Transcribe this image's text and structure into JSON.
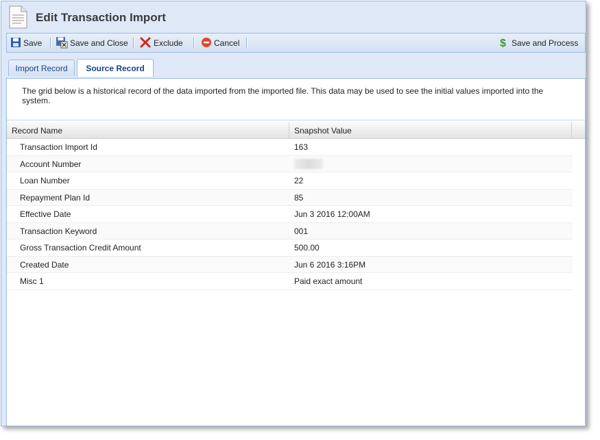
{
  "window": {
    "title": "Edit Transaction Import"
  },
  "toolbar": {
    "save_label": "Save",
    "save_close_label": "Save and Close",
    "exclude_label": "Exclude",
    "cancel_label": "Cancel",
    "save_process_label": "Save and Process"
  },
  "tabs": [
    {
      "label": "Import Record",
      "active": false
    },
    {
      "label": "Source Record",
      "active": true
    }
  ],
  "description": "The grid below is a historical record of the data imported from the imported file. This data may be used to see the initial values imported into the system.",
  "grid": {
    "columns": [
      "Record Name",
      "Snapshot Value"
    ],
    "rows": [
      {
        "name": "Transaction Import Id",
        "value": "163"
      },
      {
        "name": "Account Number",
        "value": ""
      },
      {
        "name": "Loan Number",
        "value": "22"
      },
      {
        "name": "Repayment Plan Id",
        "value": "85"
      },
      {
        "name": "Effective Date",
        "value": "Jun 3 2016 12:00AM"
      },
      {
        "name": "Transaction Keyword",
        "value": "001"
      },
      {
        "name": "Gross Transaction Credit Amount",
        "value": "500.00"
      },
      {
        "name": "Created Date",
        "value": "Jun 6 2016 3:16PM"
      },
      {
        "name": "Misc 1",
        "value": "Paid exact amount"
      }
    ]
  },
  "colors": {
    "accent": "#15428b",
    "border": "#99bbe8",
    "window_bg": "#dfe8f6"
  },
  "icons": [
    "document-icon",
    "save-icon",
    "save-close-icon",
    "exclude-icon",
    "cancel-icon",
    "save-process-icon"
  ]
}
